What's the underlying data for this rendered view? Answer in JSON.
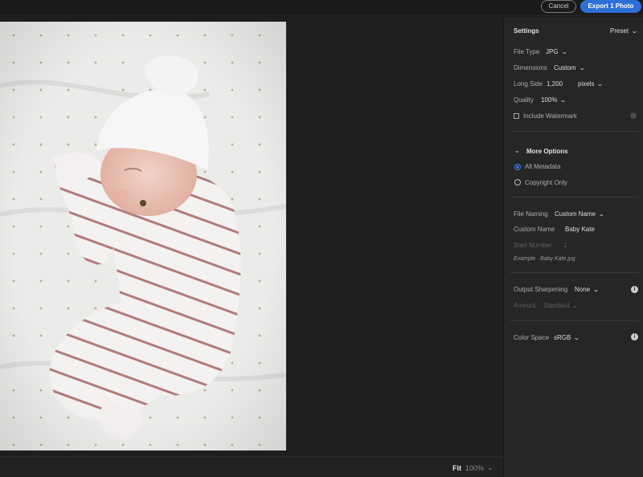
{
  "topbar": {
    "cancel_label": "Cancel",
    "export_label": "Export 1 Photo",
    "accent": "#2d6fd6"
  },
  "preview": {
    "fit_label": "Fit",
    "zoom_label": "100%"
  },
  "settings": {
    "title": "Settings",
    "preset_label": "Preset",
    "file_type_label": "File Type",
    "file_type_value": "JPG",
    "dimensions_label": "Dimensions",
    "dimensions_value": "Custom",
    "long_side_label": "Long Side",
    "long_side_value": "1,200",
    "long_side_unit": "pixels",
    "quality_label": "Quality",
    "quality_value": "100%",
    "watermark_label": "Include Watermark"
  },
  "more_options": {
    "title": "More Options",
    "metadata_all": "All Metadata",
    "metadata_copyright": "Copyright Only"
  },
  "naming": {
    "file_naming_label": "File Naming",
    "file_naming_value": "Custom Name",
    "custom_name_label": "Custom Name",
    "custom_name_value": "Baby Kate",
    "start_number_label": "Start Number",
    "start_number_value": "1",
    "example_label": "Example",
    "example_value": "Baby Kate.jpg"
  },
  "sharpening": {
    "label": "Output Sharpening",
    "value": "None",
    "amount_label": "Amount",
    "amount_value": "Standard"
  },
  "color": {
    "label": "Color Space",
    "value": "sRGB"
  },
  "icons": [
    "chevron-down-icon",
    "info-icon",
    "radio-icon",
    "checkbox-icon"
  ]
}
